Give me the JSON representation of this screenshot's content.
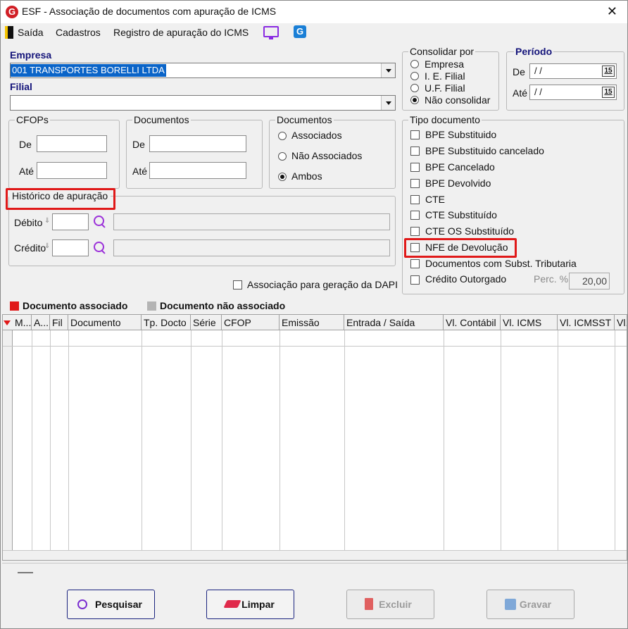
{
  "window": {
    "title": "ESF - Associação de documentos com apuração de ICMS",
    "app_icon": "G",
    "close": "✕"
  },
  "menu": {
    "items": [
      "Saída",
      "Cadastros",
      "Registro de apuração do ICMS"
    ],
    "extra_icon": "G"
  },
  "empresa": {
    "label": "Empresa",
    "value": "001 TRANSPORTES BORELLI LTDA"
  },
  "filial": {
    "label": "Filial",
    "value": ""
  },
  "consolidar": {
    "legend": "Consolidar por",
    "options": [
      "Empresa",
      "I. E. Filial",
      "U.F. Filial",
      "Não consolidar"
    ],
    "selected": "Não consolidar"
  },
  "periodo": {
    "legend": "Período",
    "de_label": "De",
    "de_value": "/ /",
    "ate_label": "Até",
    "ate_value": "/ /",
    "cal_label": "15"
  },
  "cfops": {
    "legend": "CFOPs",
    "de_label": "De",
    "ate_label": "Até"
  },
  "documentos": {
    "legend": "Documentos",
    "de_label": "De",
    "ate_label": "Até"
  },
  "documentos_assoc": {
    "legend": "Documentos",
    "options": [
      "Associados",
      "Não Associados",
      "Ambos"
    ],
    "selected": "Ambos"
  },
  "historico": {
    "legend": "Histórico de apuração",
    "debito_label": "Débito",
    "credito_label": "Crédito"
  },
  "tipo_documento": {
    "legend": "Tipo documento",
    "options": [
      "BPE Substituido",
      "BPE Substituido cancelado",
      "BPE Cancelado",
      "BPE Devolvido",
      "CTE",
      "CTE Substituído",
      "CTE OS Substituído",
      "NFE de Devolução",
      "Documentos com Subst. Tributaria",
      "Crédito Outorgado"
    ],
    "perc_label": "Perc. %",
    "perc_value": "20,00"
  },
  "dapi": {
    "label": "Associação para geração da DAPI"
  },
  "legend": {
    "associado": "Documento associado",
    "nao_associado": "Documento não associado",
    "associado_color": "#e01919",
    "nao_associado_color": "#b4b4b4"
  },
  "grid": {
    "columns": [
      "M...",
      "A...",
      "Fil",
      "Documento",
      "Tp. Docto",
      "Série",
      "CFOP",
      "Emissão",
      "Entrada / Saída",
      "Vl. Contábil",
      "Vl. ICMS",
      "Vl. ICMSST",
      "Vl."
    ]
  },
  "buttons": {
    "pesquisar": "Pesquisar",
    "limpar": "Limpar",
    "excluir": "Excluir",
    "gravar": "Gravar"
  }
}
